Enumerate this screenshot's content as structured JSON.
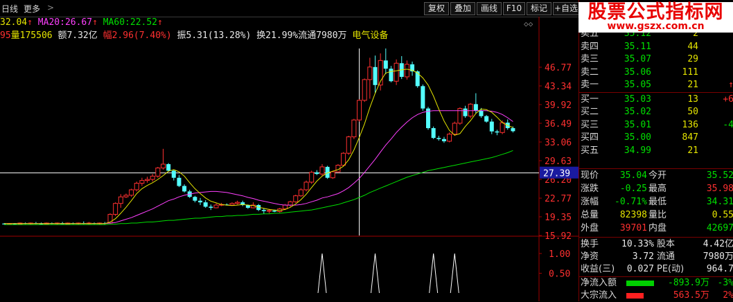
{
  "toolbar": {
    "period_label": "日线",
    "more_label": "更多",
    "more_arrow": ">",
    "buttons": [
      "复权",
      "叠加",
      "画线",
      "F10",
      "标记",
      "+自选"
    ]
  },
  "ma_line": {
    "ma5_value": "32.04",
    "ma20_label": "MA20:",
    "ma20_value": "26.67",
    "ma60_label": "MA60:",
    "ma60_value": "22.52",
    "arrow": "↑",
    "colors": {
      "ma5": "#e5e500",
      "ma20": "#ff40ff",
      "ma60": "#00e000"
    }
  },
  "info_line": {
    "prefix": "95",
    "volume": "量175506",
    "amount": "额7.32亿",
    "change": "幅2.96(7.40%)",
    "amplitude": "振5.31(13.28%)",
    "turnover": "换21.99%",
    "float": "流通7980万",
    "sector": "电气设备"
  },
  "price_axis": {
    "ticks": [
      "46.77",
      "43.34",
      "39.92",
      "36.49",
      "33.06",
      "29.63",
      "26.20",
      "22.77",
      "19.35",
      "15.92"
    ],
    "cursor_value": "27.39",
    "indicator_ticks": [
      "1.00",
      "0.50"
    ]
  },
  "chart_data": {
    "type": "candlestick",
    "ylim": [
      15.92,
      50.2
    ],
    "candles": [
      [
        18.1,
        18.2,
        17.9,
        18.0
      ],
      [
        18.0,
        18.2,
        17.9,
        18.1
      ],
      [
        18.1,
        18.2,
        17.9,
        18.0
      ],
      [
        18.0,
        18.3,
        17.9,
        18.2
      ],
      [
        18.2,
        18.3,
        18.0,
        18.1
      ],
      [
        18.1,
        18.3,
        17.9,
        18.2
      ],
      [
        18.2,
        18.4,
        18.0,
        18.1
      ],
      [
        18.1,
        18.3,
        17.9,
        18.0
      ],
      [
        18.0,
        18.3,
        17.9,
        18.2
      ],
      [
        18.2,
        18.3,
        18.0,
        18.1
      ],
      [
        18.1,
        18.3,
        17.9,
        18.2
      ],
      [
        18.2,
        18.4,
        18.0,
        18.0
      ],
      [
        18.0,
        18.3,
        17.9,
        18.2
      ],
      [
        18.2,
        18.3,
        18.0,
        18.1
      ],
      [
        18.1,
        18.3,
        17.9,
        18.2
      ],
      [
        18.2,
        18.5,
        18.0,
        18.1
      ],
      [
        18.1,
        18.4,
        17.9,
        18.2
      ],
      [
        18.2,
        18.3,
        18.0,
        18.1
      ],
      [
        18.1,
        18.3,
        17.9,
        18.2
      ],
      [
        18.2,
        18.4,
        18.0,
        18.1
      ],
      [
        18.2,
        20.0,
        18.0,
        19.8
      ],
      [
        19.8,
        22.0,
        19.5,
        21.8
      ],
      [
        21.8,
        23.5,
        21.0,
        23.0
      ],
      [
        23.0,
        23.6,
        22.8,
        23.3
      ],
      [
        23.3,
        24.5,
        23.0,
        24.3
      ],
      [
        24.3,
        25.8,
        24.0,
        25.5
      ],
      [
        25.5,
        26.5,
        25.0,
        26.0
      ],
      [
        26.0,
        26.7,
        25.6,
        26.2
      ],
      [
        26.2,
        27.2,
        25.8,
        26.8
      ],
      [
        26.8,
        28.5,
        26.5,
        28.3
      ],
      [
        28.3,
        31.8,
        28.0,
        29.0
      ],
      [
        29.0,
        29.2,
        27.6,
        27.8
      ],
      [
        27.8,
        28.0,
        26.0,
        26.5
      ],
      [
        26.5,
        27.0,
        24.8,
        25.0
      ],
      [
        25.0,
        25.3,
        23.8,
        24.0
      ],
      [
        24.0,
        24.3,
        22.8,
        23.0
      ],
      [
        23.0,
        23.2,
        22.0,
        22.3
      ],
      [
        22.3,
        22.8,
        21.5,
        22.0
      ],
      [
        22.0,
        22.4,
        21.0,
        21.2
      ],
      [
        21.2,
        21.6,
        20.6,
        21.0
      ],
      [
        21.0,
        21.8,
        20.9,
        21.5
      ],
      [
        21.5,
        21.9,
        21.3,
        21.6
      ],
      [
        21.6,
        21.8,
        21.4,
        21.5
      ],
      [
        21.5,
        22.0,
        21.4,
        21.8
      ],
      [
        21.8,
        22.3,
        21.6,
        22.0
      ],
      [
        22.0,
        22.3,
        21.3,
        21.5
      ],
      [
        21.5,
        21.6,
        20.8,
        21.0
      ],
      [
        21.0,
        22.0,
        20.9,
        21.5
      ],
      [
        21.5,
        21.7,
        20.4,
        20.6
      ],
      [
        20.6,
        20.9,
        19.9,
        20.4
      ],
      [
        20.4,
        20.8,
        20.0,
        20.5
      ],
      [
        20.5,
        20.6,
        20.2,
        20.3
      ],
      [
        20.3,
        21.0,
        20.1,
        20.8
      ],
      [
        20.8,
        21.7,
        20.6,
        21.5
      ],
      [
        21.5,
        22.3,
        21.2,
        22.1
      ],
      [
        22.1,
        23.4,
        21.9,
        23.2
      ],
      [
        23.2,
        24.6,
        23.0,
        24.3
      ],
      [
        24.3,
        26.0,
        24.0,
        25.7
      ],
      [
        25.7,
        27.8,
        25.4,
        27.5
      ],
      [
        27.5,
        27.9,
        27.0,
        27.2
      ],
      [
        27.2,
        29.0,
        26.8,
        28.5
      ],
      [
        28.5,
        28.7,
        26.3,
        26.5
      ],
      [
        26.5,
        27.8,
        26.3,
        27.6
      ],
      [
        27.6,
        29.0,
        27.4,
        28.8
      ],
      [
        28.8,
        31.2,
        28.6,
        31.0
      ],
      [
        31.0,
        34.2,
        30.7,
        34.0
      ],
      [
        34.0,
        37.3,
        33.6,
        37.1
      ],
      [
        37.1,
        40.9,
        36.8,
        40.7
      ],
      [
        40.7,
        44.7,
        40.4,
        44.5
      ],
      [
        44.5,
        48.5,
        41.0,
        46.8
      ],
      [
        46.8,
        48.9,
        42.0,
        43.5
      ],
      [
        43.5,
        49.3,
        42.5,
        48.0
      ],
      [
        48.0,
        50.2,
        45.5,
        46.5
      ],
      [
        46.5,
        47.0,
        44.0,
        44.2
      ],
      [
        44.2,
        48.2,
        43.5,
        47.5
      ],
      [
        47.5,
        48.8,
        44.6,
        45.0
      ],
      [
        45.0,
        48.0,
        44.5,
        47.3
      ],
      [
        47.3,
        47.8,
        45.2,
        46.0
      ],
      [
        46.0,
        46.2,
        43.0,
        43.3
      ],
      [
        43.3,
        43.6,
        38.8,
        39.2
      ],
      [
        39.2,
        39.5,
        35.3,
        35.6
      ],
      [
        35.6,
        35.9,
        33.6,
        33.8
      ],
      [
        33.8,
        34.2,
        33.3,
        33.6
      ],
      [
        33.6,
        34.0,
        32.9,
        33.2
      ],
      [
        33.2,
        34.8,
        33.0,
        34.5
      ],
      [
        34.5,
        36.8,
        34.2,
        36.5
      ],
      [
        36.5,
        39.4,
        36.2,
        39.2
      ],
      [
        39.2,
        39.7,
        37.5,
        37.8
      ],
      [
        37.8,
        40.2,
        37.4,
        40.0
      ],
      [
        40.0,
        42.0,
        38.3,
        38.8
      ],
      [
        38.8,
        39.3,
        37.5,
        37.8
      ],
      [
        37.8,
        38.0,
        36.6,
        36.8
      ],
      [
        36.8,
        37.3,
        34.5,
        35.0
      ],
      [
        35.0,
        35.3,
        34.3,
        34.8
      ],
      [
        34.8,
        37.0,
        34.5,
        36.6
      ],
      [
        36.6,
        37.2,
        35.3,
        35.6
      ],
      [
        35.6,
        35.9,
        34.8,
        35.04
      ]
    ],
    "ma5": [
      18.1,
      18.1,
      18.1,
      18.1,
      18.1,
      18.1,
      18.1,
      18.1,
      18.1,
      18.1,
      18.1,
      18.1,
      18.1,
      18.1,
      18.1,
      18.1,
      18.1,
      18.1,
      18.1,
      18.1,
      18.4,
      19.0,
      20.0,
      21.1,
      22.3,
      23.6,
      24.5,
      25.1,
      25.6,
      26.2,
      26.9,
      27.7,
      28.0,
      27.6,
      26.8,
      25.6,
      24.5,
      23.6,
      22.8,
      22.2,
      21.9,
      21.6,
      21.5,
      21.4,
      21.5,
      21.6,
      21.5,
      21.4,
      21.1,
      20.9,
      20.7,
      20.6,
      20.5,
      20.7,
      21.1,
      21.7,
      22.5,
      23.5,
      24.7,
      25.9,
      26.8,
      27.4,
      27.7,
      28.0,
      28.6,
      29.8,
      31.6,
      33.9,
      36.4,
      39.4,
      42.0,
      44.2,
      45.7,
      46.0,
      46.1,
      46.3,
      46.4,
      46.2,
      45.7,
      44.8,
      43.5,
      41.5,
      39.1,
      36.9,
      35.2,
      34.3,
      34.6,
      35.9,
      37.0,
      38.3,
      39.1,
      39.0,
      38.5,
      37.6,
      36.6,
      36.1,
      35.7
    ],
    "ma20": [
      18.1,
      18.1,
      18.1,
      18.1,
      18.1,
      18.1,
      18.1,
      18.1,
      18.1,
      18.1,
      18.1,
      18.1,
      18.1,
      18.1,
      18.1,
      18.1,
      18.1,
      18.1,
      18.1,
      18.1,
      18.2,
      18.3,
      18.6,
      18.9,
      19.2,
      19.6,
      20.0,
      20.4,
      20.8,
      21.3,
      21.8,
      22.3,
      22.6,
      23.0,
      23.3,
      23.5,
      23.7,
      23.8,
      23.9,
      24.0,
      24.0,
      23.9,
      23.8,
      23.6,
      23.4,
      23.2,
      22.9,
      22.7,
      22.4,
      22.2,
      22.0,
      21.8,
      21.6,
      21.5,
      21.5,
      21.5,
      21.6,
      21.8,
      22.1,
      22.4,
      22.8,
      23.0,
      23.3,
      23.6,
      24.1,
      24.7,
      25.5,
      26.4,
      27.5,
      28.7,
      29.9,
      31.2,
      32.5,
      33.6,
      34.8,
      35.8,
      36.7,
      37.5,
      38.1,
      38.5,
      38.7,
      38.8,
      38.8,
      38.8,
      38.8,
      38.8,
      38.8,
      38.8,
      38.8,
      38.8,
      38.8,
      38.8,
      38.7,
      38.5,
      38.1,
      37.5,
      36.8
    ],
    "ma60": [
      17.9,
      17.9,
      17.9,
      17.9,
      17.9,
      17.9,
      17.9,
      17.9,
      17.9,
      17.9,
      17.9,
      17.9,
      17.9,
      17.9,
      17.9,
      17.9,
      17.9,
      17.9,
      17.9,
      17.9,
      18.0,
      18.0,
      18.1,
      18.1,
      18.2,
      18.2,
      18.3,
      18.4,
      18.4,
      18.5,
      18.6,
      18.7,
      18.7,
      18.8,
      18.9,
      19.0,
      19.1,
      19.1,
      19.2,
      19.3,
      19.4,
      19.4,
      19.5,
      19.5,
      19.6,
      19.6,
      19.7,
      19.8,
      19.8,
      19.9,
      19.9,
      20.0,
      20.0,
      20.1,
      20.2,
      20.3,
      20.4,
      20.5,
      20.6,
      20.8,
      21.0,
      21.2,
      21.4,
      21.6,
      21.9,
      22.2,
      22.5,
      22.9,
      23.3,
      23.8,
      24.2,
      24.6,
      25.0,
      25.4,
      25.8,
      26.2,
      26.6,
      26.9,
      27.2,
      27.5,
      27.8,
      28.0,
      28.2,
      28.4,
      28.6,
      28.8,
      29.0,
      29.2,
      29.4,
      29.6,
      29.8,
      30.0,
      30.2,
      30.5,
      30.8,
      31.1,
      31.5
    ],
    "indicator": {
      "ylim": [
        0,
        1
      ],
      "pulses": [
        60,
        70,
        81,
        85
      ]
    }
  },
  "quotes": {
    "sells": [
      {
        "label": "卖五",
        "price": "35.12",
        "vol": "2",
        "chg": ""
      },
      {
        "label": "卖四",
        "price": "35.11",
        "vol": "44",
        "chg": ""
      },
      {
        "label": "卖三",
        "price": "35.07",
        "vol": "29",
        "chg": ""
      },
      {
        "label": "卖二",
        "price": "35.06",
        "vol": "111",
        "chg": ""
      },
      {
        "label": "卖一",
        "price": "35.05",
        "vol": "21",
        "chg": "↑"
      }
    ],
    "buys": [
      {
        "label": "买一",
        "price": "35.03",
        "vol": "13",
        "chg": "+6"
      },
      {
        "label": "买二",
        "price": "35.02",
        "vol": "50",
        "chg": ""
      },
      {
        "label": "买三",
        "price": "35.01",
        "vol": "136",
        "chg": "-4"
      },
      {
        "label": "买四",
        "price": "35.00",
        "vol": "847",
        "chg": ""
      },
      {
        "label": "买五",
        "price": "34.99",
        "vol": "21",
        "chg": ""
      }
    ]
  },
  "stats": [
    {
      "l1": "现价",
      "v1": "35.04",
      "c1": "green",
      "l2": "今开",
      "v2": "35.52",
      "c2": "green"
    },
    {
      "l1": "涨跌",
      "v1": "-0.25",
      "c1": "green",
      "l2": "最高",
      "v2": "35.98",
      "c2": "red"
    },
    {
      "l1": "涨幅",
      "v1": "-0.71%",
      "c1": "green",
      "l2": "最低",
      "v2": "34.31",
      "c2": "green"
    },
    {
      "l1": "总量",
      "v1": "82398",
      "c1": "yellow",
      "l2": "量比",
      "v2": "0.55",
      "c2": "yellow"
    },
    {
      "l1": "外盘",
      "v1": "39701",
      "c1": "red",
      "l2": "内盘",
      "v2": "42697",
      "c2": "green"
    }
  ],
  "stats2": [
    {
      "l1": "换手",
      "v1": "10.33%",
      "l2": "股本",
      "v2": "4.42亿"
    },
    {
      "l1": "净资",
      "v1": "3.72",
      "l2": "流通",
      "v2": "7980万"
    },
    {
      "l1": "收益(三)",
      "v1": "0.027",
      "l2": "PE(动)",
      "v2": "964.7"
    }
  ],
  "flows": [
    {
      "label": "净流入额",
      "value": "-893.9万",
      "pct": "-3%",
      "bar_color": "#00d000",
      "bar_level": 0.8
    },
    {
      "label": "大宗流入",
      "value": "563.5万",
      "pct": "2%",
      "bar_color": "#ff2020",
      "bar_level": 0.5
    }
  ],
  "watermark": {
    "title": "股票公式指标网",
    "url": "www.gszx.com.cn"
  }
}
